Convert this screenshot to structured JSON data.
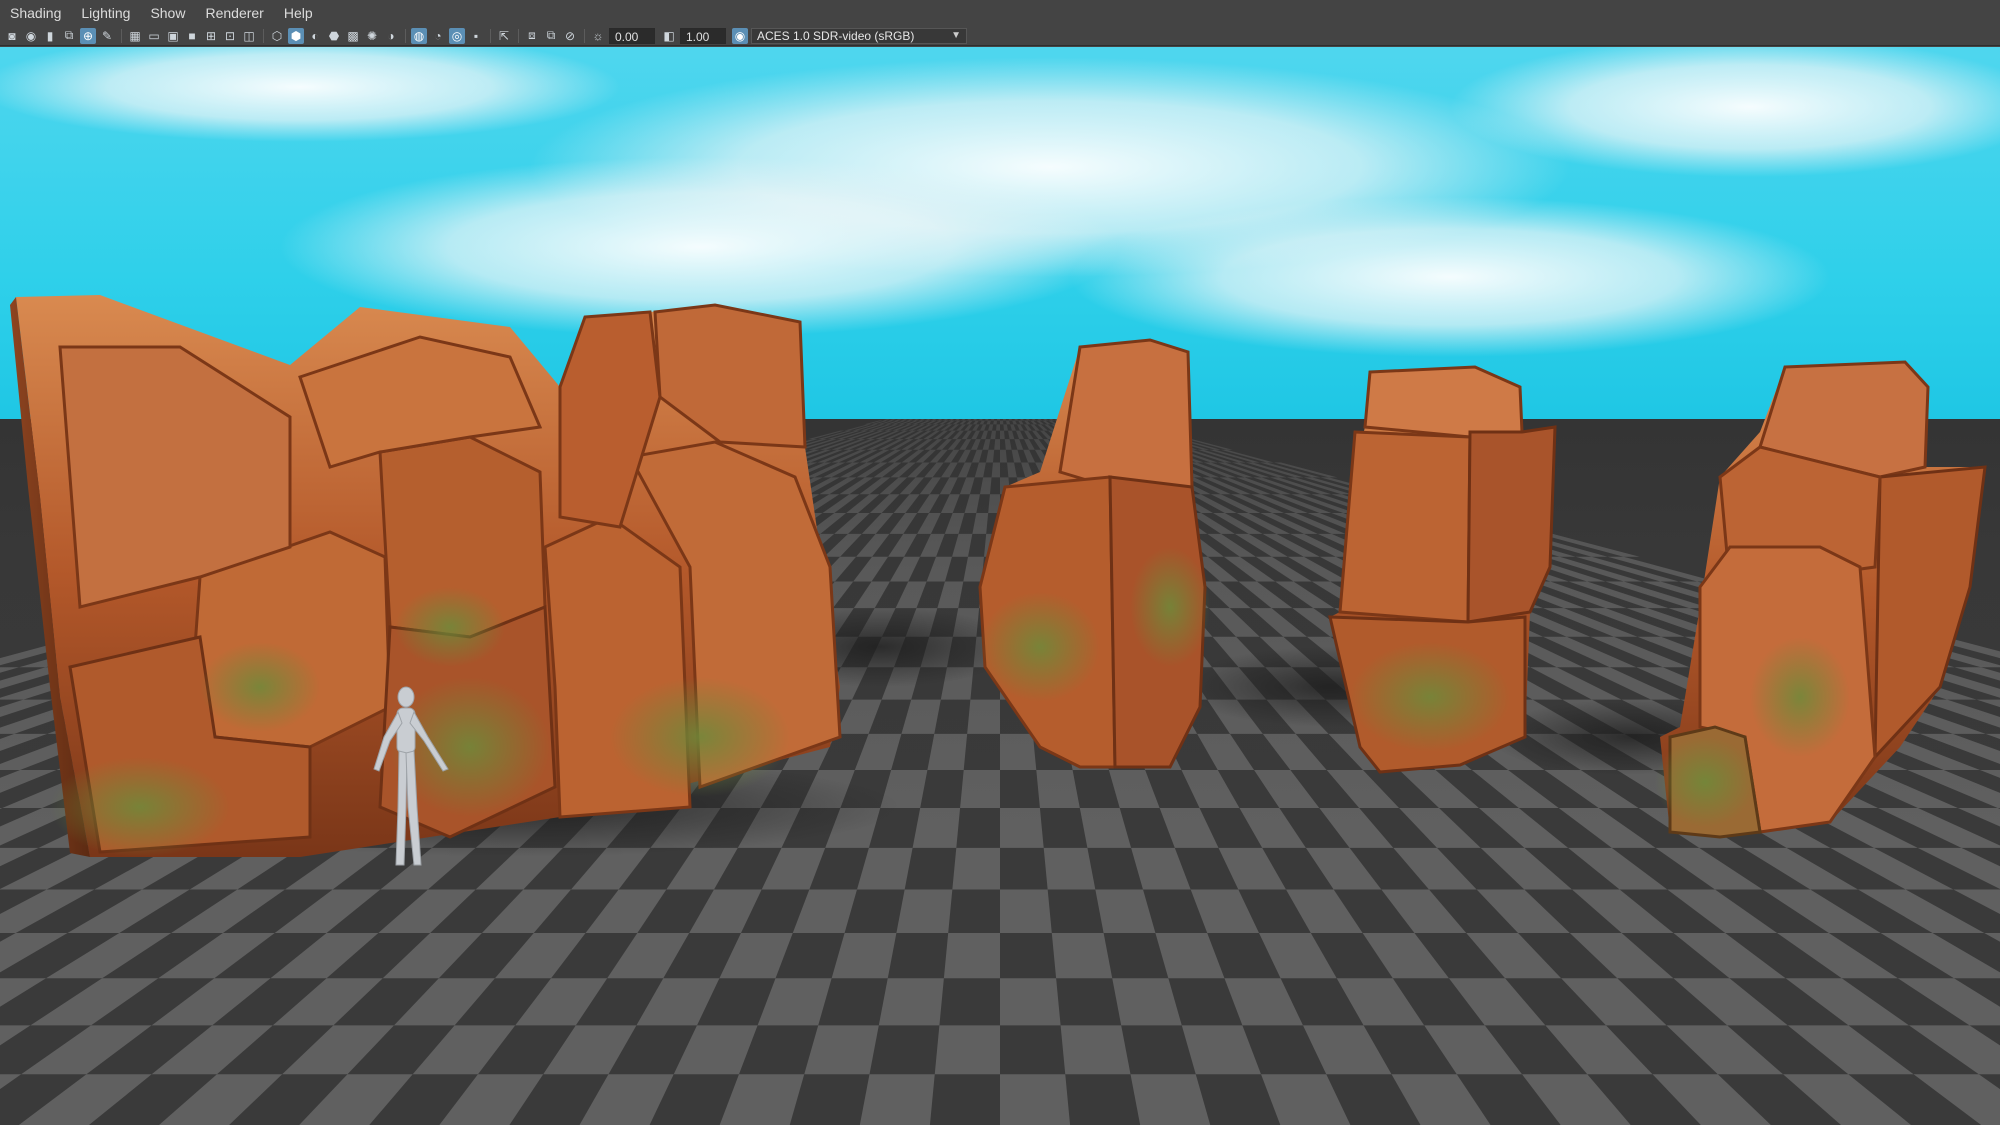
{
  "menu": {
    "shading": "Shading",
    "lighting": "Lighting",
    "show": "Show",
    "renderer": "Renderer",
    "help": "Help"
  },
  "toolbar": {
    "exposure_value": "0.00",
    "gamma_value": "1.00",
    "color_space": "ACES 1.0 SDR-video (sRGB)"
  },
  "colors": {
    "ui_background": "#444444",
    "sky_top": "#4fd6ee",
    "sky_cloud": "#f2f6f8",
    "grid_dark": "#3a3a3a",
    "grid_light": "#606060",
    "rock_base": "#b3582a",
    "rock_highlight": "#d98a50",
    "moss": "#6e8a3a"
  },
  "viewport": {
    "objects": [
      "rock-cliff-wall",
      "human-reference-figure",
      "rock-pillar-1",
      "rock-pillar-2",
      "rock-pillar-3"
    ]
  }
}
